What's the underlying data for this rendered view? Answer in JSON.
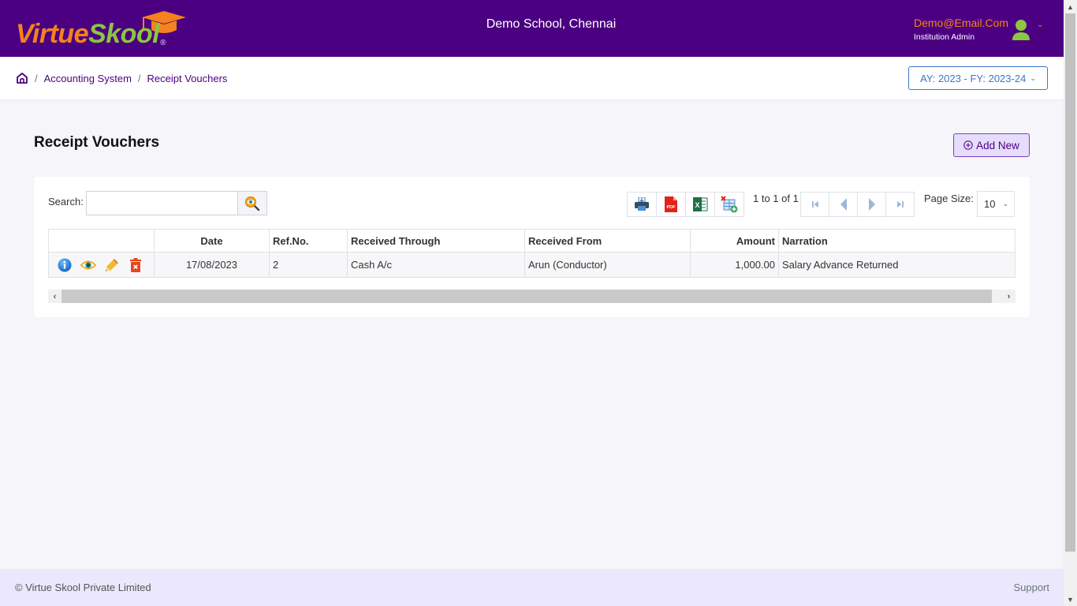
{
  "header": {
    "logo_part1": "Virtue",
    "logo_part2": "Skool",
    "logo_reg": "®",
    "school_name": "Demo School, Chennai",
    "user_email": "Demo@Email.Com",
    "user_role": "Institution Admin",
    "colors": {
      "bar": "#4b0082",
      "orange": "#f5821f",
      "green": "#8cc63f"
    }
  },
  "breadcrumb": {
    "home_icon": "home-icon",
    "items": [
      "Accounting System",
      "Receipt Vouchers"
    ],
    "separator": "/"
  },
  "year_selector": {
    "value": "AY: 2023 - FY: 2023-24"
  },
  "page": {
    "title": "Receipt Vouchers",
    "add_button": "Add New"
  },
  "toolbar": {
    "search_label": "Search:",
    "search_value": "",
    "search_placeholder": "",
    "export_buttons": [
      "print-icon",
      "pdf-icon",
      "excel-icon",
      "export-table-icon"
    ],
    "page_info": "1 to 1 of 1",
    "pager_buttons": [
      "first-page",
      "previous-page",
      "next-page",
      "last-page"
    ],
    "page_size_label": "Page Size:",
    "page_size_value": "10"
  },
  "table": {
    "columns": [
      "",
      "Date",
      "Ref.No.",
      "Received Through",
      "Received From",
      "Amount",
      "Narration"
    ],
    "rows": [
      {
        "actions": [
          "info",
          "view",
          "edit",
          "delete"
        ],
        "date": "17/08/2023",
        "ref_no": "2",
        "received_through": "Cash A/c",
        "received_from": "Arun (Conductor)",
        "amount": "1,000.00",
        "narration": "Salary Advance Returned"
      }
    ]
  },
  "footer": {
    "copyright": "© Virtue Skool Private Limited",
    "support": "Support"
  }
}
